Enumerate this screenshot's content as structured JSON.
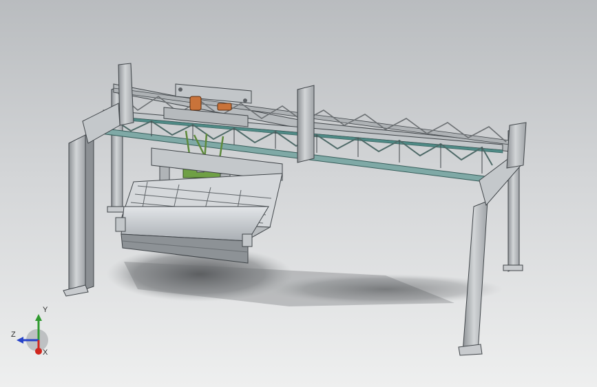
{
  "viewport": {
    "background_top": "#b9bcbf",
    "background_bottom": "#eeefef"
  },
  "model": {
    "frame_color": "#b7bbbe",
    "frame_edge_color": "#3f4448",
    "truss_accent_color": "#4f8a86",
    "motor_color": "#c9733a",
    "bracket_color": "#5e8a3c"
  },
  "triad": {
    "x_label": "X",
    "y_label": "Y",
    "z_label": "Z",
    "x_color": "#d0261e",
    "y_color": "#2f9a2f",
    "z_color": "#2743c9"
  }
}
